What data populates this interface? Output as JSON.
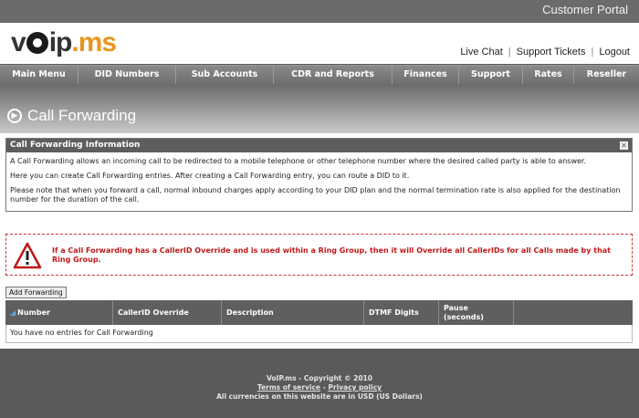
{
  "header": {
    "portal_title": "Customer Portal",
    "logo_part1": "v",
    "logo_part2": "ip",
    "logo_part3": ".ms",
    "links": [
      "Live Chat",
      "Support Tickets",
      "Logout"
    ]
  },
  "nav": {
    "items": [
      "Main Menu",
      "DID Numbers",
      "Sub Accounts",
      "CDR and Reports",
      "Finances",
      "Support",
      "Rates",
      "Reseller"
    ]
  },
  "page": {
    "title": "Call Forwarding"
  },
  "infobox": {
    "title": "Call Forwarding Information",
    "close_glyph": "✕",
    "paragraphs": [
      "A Call Forwarding allows an incoming call to be redirected to a mobile telephone or other telephone number where the desired called party is able to answer.",
      "Here you can create Call Forwarding entries. After creating a Call Forwarding entry, you can route a DID to it.",
      "Please note that when you forward a call, normal inbound charges apply according to your DID plan and the normal termination rate is also applied for the destination number for the duration of the call."
    ]
  },
  "warning": {
    "text": "If a Call Forwarding has a CallerID Override and is used within a Ring Group, then it will Override all CallerIDs for all Calls made by that Ring Group.",
    "icon": "warning-triangle-icon"
  },
  "toolbar": {
    "add_label": "Add Forwarding"
  },
  "grid": {
    "columns": [
      "Number",
      "CallerID Override",
      "Description",
      "DTMF Digits",
      "Pause",
      "(seconds)",
      ""
    ],
    "empty_message": "You have no entries for Call Forwarding"
  },
  "footer": {
    "copyright": "VoIP.ms - Copyright © 2010",
    "terms": "Terms of service",
    "separator": " - ",
    "privacy": "Privacy policy",
    "currency_note": "All currencies on this website are in USD (US Dollars)"
  },
  "colors": {
    "accent": "#e8951e",
    "warning_red": "#c01818",
    "header_gray": "#5f5f5f"
  }
}
